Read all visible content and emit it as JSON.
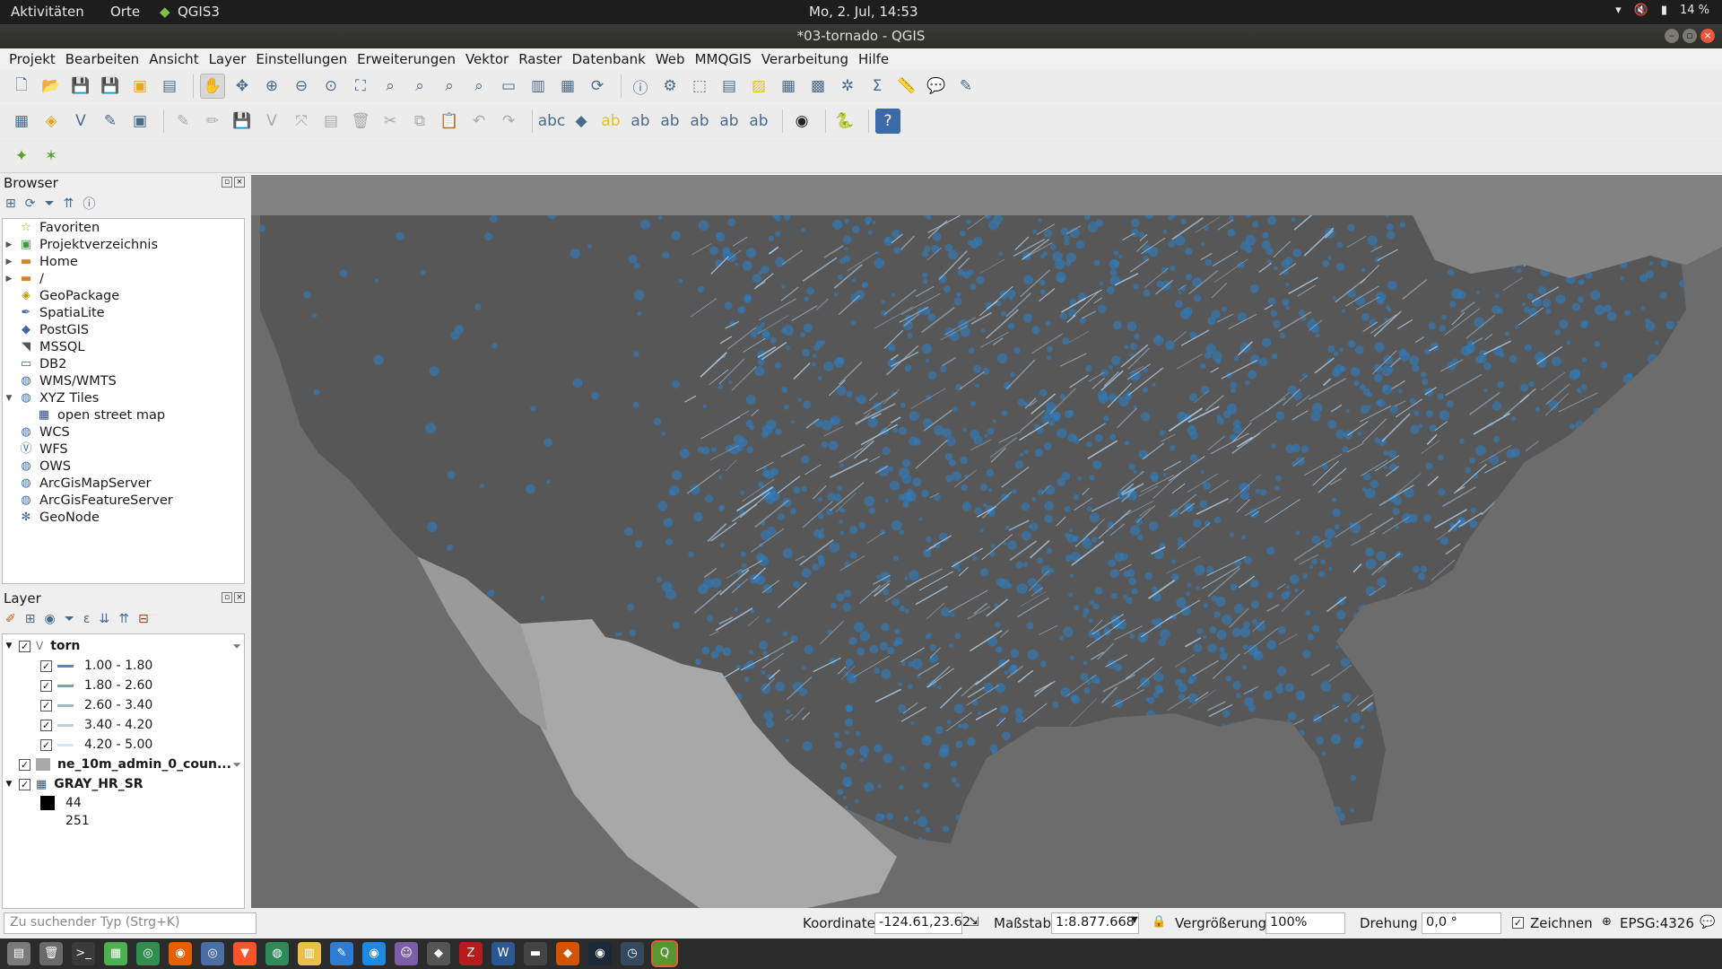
{
  "topbar": {
    "activities": "Aktivitäten",
    "places": "Orte",
    "app_name": "QGIS3",
    "clock": "Mo,  2. Jul, 14:53",
    "battery": "14 %"
  },
  "window": {
    "title": "*03-tornado - QGIS"
  },
  "menubar": [
    "Projekt",
    "Bearbeiten",
    "Ansicht",
    "Layer",
    "Einstellungen",
    "Erweiterungen",
    "Vektor",
    "Raster",
    "Datenbank",
    "Web",
    "MMQGIS",
    "Verarbeitung",
    "Hilfe"
  ],
  "browser": {
    "title": "Browser",
    "items": [
      {
        "label": "Favoriten",
        "icon": "star-icon",
        "expander": ""
      },
      {
        "label": "Projektverzeichnis",
        "icon": "project-folder-icon",
        "expander": "▶"
      },
      {
        "label": "Home",
        "icon": "folder-icon",
        "expander": "▶"
      },
      {
        "label": "/",
        "icon": "folder-icon",
        "expander": "▶"
      },
      {
        "label": "GeoPackage",
        "icon": "geopackage-icon",
        "expander": ""
      },
      {
        "label": "SpatiaLite",
        "icon": "spatialite-icon",
        "expander": ""
      },
      {
        "label": "PostGIS",
        "icon": "postgis-icon",
        "expander": ""
      },
      {
        "label": "MSSQL",
        "icon": "mssql-icon",
        "expander": ""
      },
      {
        "label": "DB2",
        "icon": "db2-icon",
        "expander": ""
      },
      {
        "label": "WMS/WMTS",
        "icon": "globe-icon",
        "expander": ""
      },
      {
        "label": "XYZ Tiles",
        "icon": "globe-icon",
        "expander": "▼"
      },
      {
        "label": "open street map",
        "icon": "tiles-icon",
        "expander": "",
        "indent": true
      },
      {
        "label": "WCS",
        "icon": "globe-icon",
        "expander": ""
      },
      {
        "label": "WFS",
        "icon": "wfs-icon",
        "expander": ""
      },
      {
        "label": "OWS",
        "icon": "globe-icon",
        "expander": ""
      },
      {
        "label": "ArcGisMapServer",
        "icon": "globe-icon",
        "expander": ""
      },
      {
        "label": "ArcGisFeatureServer",
        "icon": "globe-icon",
        "expander": ""
      },
      {
        "label": "GeoNode",
        "icon": "geonode-icon",
        "expander": ""
      }
    ]
  },
  "layers": {
    "title": "Layer",
    "torn": {
      "name": "torn",
      "classes": [
        "1.00 - 1.80",
        "1.80 - 2.60",
        "2.60 - 3.40",
        "3.40 - 4.20",
        "4.20 - 5.00"
      ]
    },
    "countries": {
      "name": "ne_10m_admin_0_coun..."
    },
    "raster": {
      "name": "GRAY_HR_SR",
      "min": "44",
      "max": "251"
    }
  },
  "statusbar": {
    "search_placeholder": "Zu suchender Typ (Strg+K)",
    "coord_label": "Koordinate",
    "coord_value": "-124.61,23.62",
    "scale_label": "Maßstab",
    "scale_value": "1:8.877.668",
    "magnifier_label": "Vergrößerung",
    "magnifier_value": "100%",
    "rotation_label": "Drehung",
    "rotation_value": "0,0 °",
    "render_label": "Zeichnen",
    "crs": "EPSG:4326"
  },
  "colors": {
    "tornado_points": "#2a7fc9",
    "tornado_tracks": "#b8d6ee",
    "ocean_land": "#6a6a6a",
    "us_mask": "#555555"
  }
}
